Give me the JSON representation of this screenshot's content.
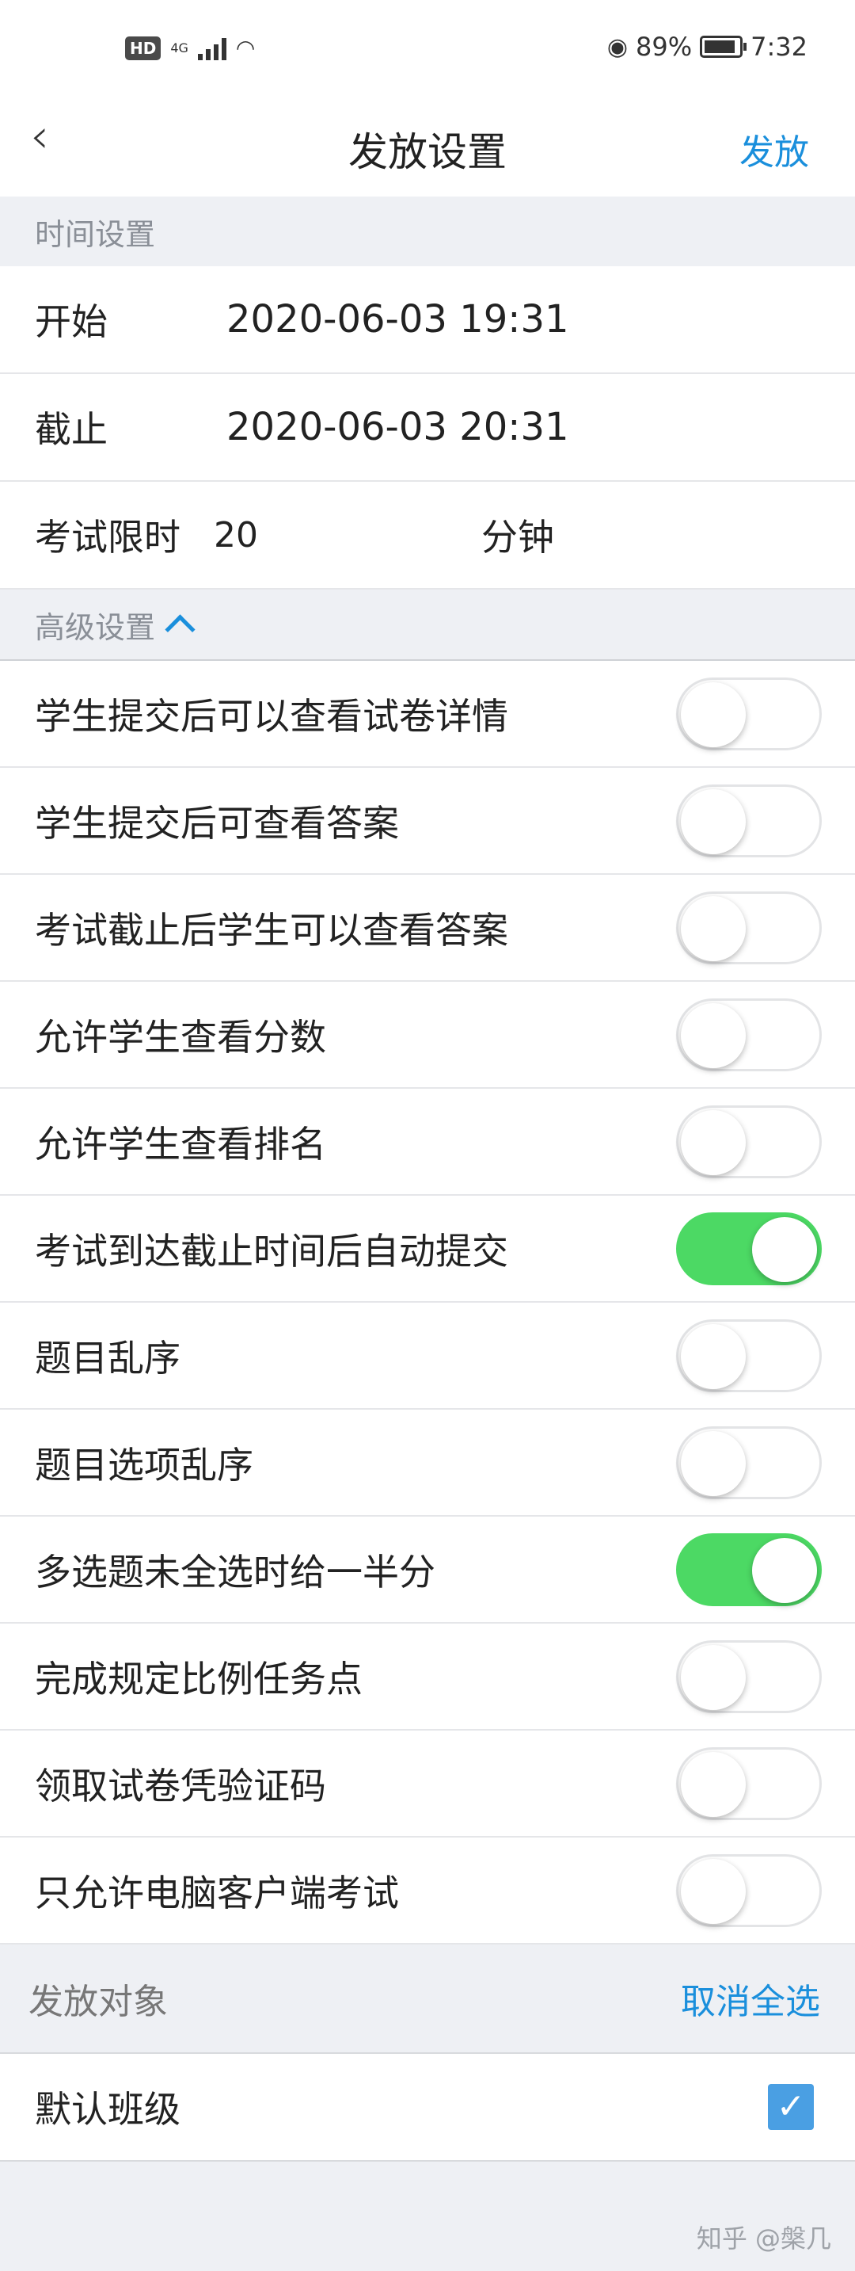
{
  "status": {
    "hd": "HD",
    "signal": "4G",
    "battery": "89%",
    "battery_level": 0.89,
    "time": "7:32"
  },
  "nav": {
    "back_icon": "chevron-left-icon",
    "title": "发放设置",
    "action": "发放"
  },
  "time_section": {
    "header": "时间设置",
    "start_label": "开始",
    "start_value": "2020-06-03 19:31",
    "end_label": "截止",
    "end_value": "2020-06-03 20:31",
    "limit_label": "考试限时",
    "limit_value": "20",
    "limit_unit": "分钟"
  },
  "advanced": {
    "header": "高级设置",
    "items": [
      {
        "label": "学生提交后可以查看试卷详情",
        "on": false
      },
      {
        "label": "学生提交后可查看答案",
        "on": false
      },
      {
        "label": "考试截止后学生可以查看答案",
        "on": false
      },
      {
        "label": "允许学生查看分数",
        "on": false
      },
      {
        "label": "允许学生查看排名",
        "on": false
      },
      {
        "label": "考试到达截止时间后自动提交",
        "on": true
      },
      {
        "label": "题目乱序",
        "on": false
      },
      {
        "label": "题目选项乱序",
        "on": false
      },
      {
        "label": "多选题未全选时给一半分",
        "on": true
      },
      {
        "label": "完成规定比例任务点",
        "on": false
      },
      {
        "label": "领取试卷凭验证码",
        "on": false
      },
      {
        "label": "只允许电脑客户端考试",
        "on": false
      }
    ]
  },
  "target": {
    "header": "发放对象",
    "action": "取消全选",
    "class_label": "默认班级",
    "class_checked": true
  },
  "watermark": "知乎 @槃几",
  "colors": {
    "accent": "#1a8fdc",
    "toggle_on": "#4cd964",
    "background": "#eef0f4"
  }
}
